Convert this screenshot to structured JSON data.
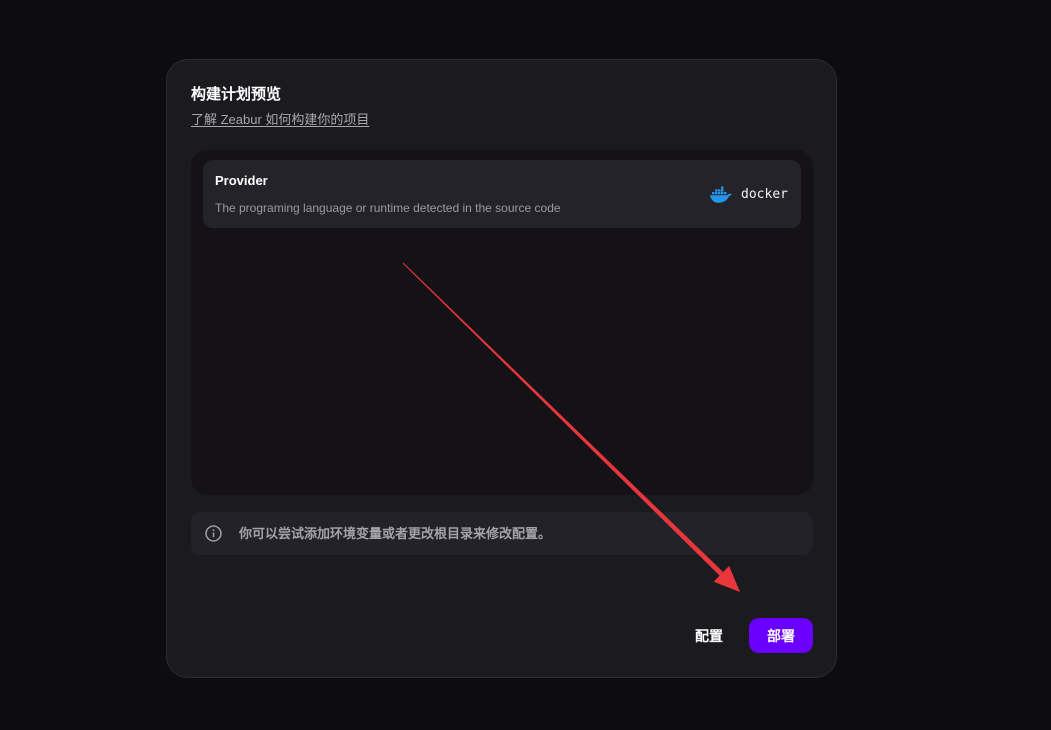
{
  "modal": {
    "title": "构建计划预览",
    "learn_link": "了解 Zeabur 如何构建你的项目"
  },
  "provider": {
    "label": "Provider",
    "description": "The programing language or runtime detected in the source code",
    "value": "docker",
    "icon": "docker-whale-icon"
  },
  "info": {
    "icon": "info-icon",
    "text": "你可以尝试添加环境变量或者更改根目录来修改配置。"
  },
  "actions": {
    "configure_label": "配置",
    "deploy_label": "部署"
  },
  "colors": {
    "accent": "#6a00ff",
    "docker_blue": "#2496ed",
    "annotation_arrow": "#e8363c"
  }
}
